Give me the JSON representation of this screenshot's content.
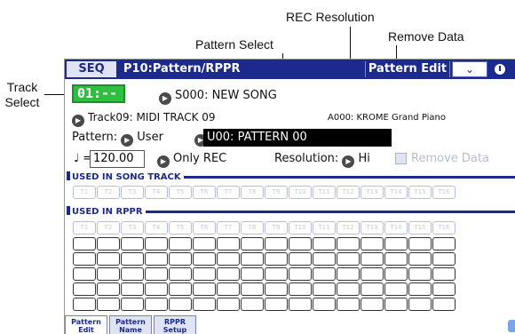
{
  "callouts": {
    "rec_resolution": "REC Resolution",
    "pattern_select": "Pattern Select",
    "remove_data": "Remove Data",
    "track_select": "Track\nSelect"
  },
  "titlebar": {
    "mode": "SEQ",
    "page": "P10:Pattern/RPPR",
    "edit": "Pattern Edit",
    "menu_icon": "chevron-down-icon",
    "clock_icon": "clock-icon"
  },
  "track_select": {
    "value": "01:--"
  },
  "song": {
    "label": "S000: NEW SONG"
  },
  "track": {
    "label": "Track09: MIDI TRACK 09",
    "program": "A000: KROME Grand Piano"
  },
  "pattern": {
    "label": "Pattern:",
    "bank": "User",
    "value": "U00: PATTERN 00"
  },
  "tempo": {
    "symbol": "♩",
    "eq": "=",
    "value": "120.00",
    "mode": "Only REC"
  },
  "resolution": {
    "label": "Resolution:",
    "value": "Hi"
  },
  "remove_data": {
    "label": "Remove Data"
  },
  "sections": {
    "song_track": "USED IN SONG TRACK",
    "rppr": "USED IN RPPR"
  },
  "tracks": [
    "T1",
    "T2",
    "T3",
    "T4",
    "T5",
    "T6",
    "T7",
    "T8",
    "T9",
    "T10",
    "T11",
    "T12",
    "T13",
    "T14",
    "T15",
    "T16"
  ],
  "tabs": [
    {
      "line1": "Pattern",
      "line2": "Edit"
    },
    {
      "line1": "Pattern",
      "line2": "Name"
    },
    {
      "line1": "RPPR",
      "line2": "Setup"
    }
  ]
}
